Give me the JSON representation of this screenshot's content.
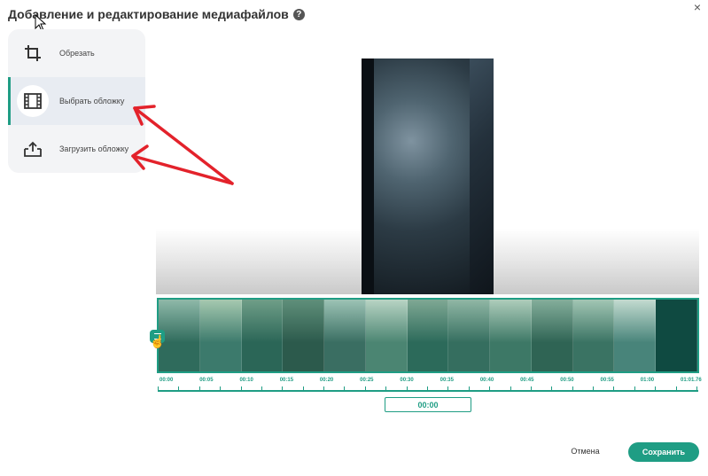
{
  "dialog": {
    "title": "Добавление и редактирование медиафайлов",
    "help_icon": "?",
    "close_icon": "×"
  },
  "menu": {
    "items": [
      {
        "label": "Обрезать",
        "icon": "crop-icon",
        "active": false
      },
      {
        "label": "Выбрать обложку",
        "icon": "film-icon",
        "active": true
      },
      {
        "label": "Загрузить обложку",
        "icon": "upload-icon",
        "active": false
      }
    ]
  },
  "timeline": {
    "labels": [
      "00:00",
      "00:05",
      "00:10",
      "00:15",
      "00:20",
      "00:25",
      "00:30",
      "00:35",
      "00:40",
      "00:45",
      "00:50",
      "00:55",
      "01:00",
      "01:01.76"
    ],
    "current_time": "00:00",
    "thumbnail_count": 13
  },
  "actions": {
    "cancel_label": "Отмена",
    "save_label": "Сохранить"
  },
  "colors": {
    "accent": "#1f9d84",
    "annotation_arrow": "#e3222b"
  }
}
